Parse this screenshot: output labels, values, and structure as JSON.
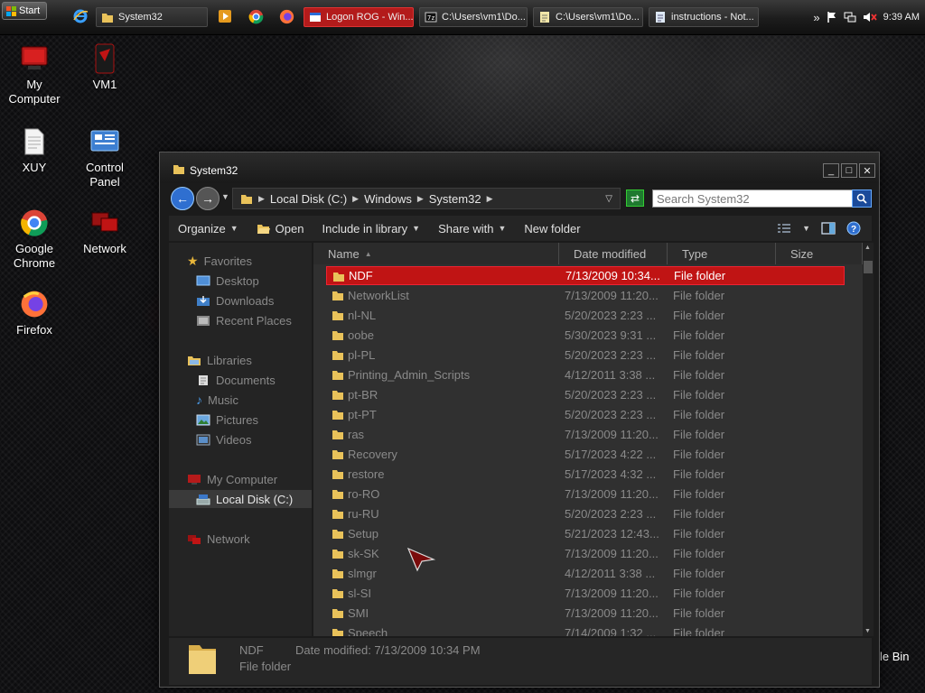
{
  "taskbar": {
    "start_label": "Start",
    "buttons": [
      {
        "label": "System32",
        "active": false
      },
      {
        "label": "Logon ROG - Win...",
        "active": true
      },
      {
        "label": "C:\\Users\\vm1\\Do...",
        "active": false
      },
      {
        "label": "C:\\Users\\vm1\\Do...",
        "active": false
      },
      {
        "label": "instructions - Not...",
        "active": false
      }
    ],
    "clock": "9:39 AM",
    "tray_expand": "»"
  },
  "desktop_icons": [
    {
      "label": "My Computer"
    },
    {
      "label": "VM1"
    },
    {
      "label": "XUY"
    },
    {
      "label": "Control Panel"
    },
    {
      "label": "Google Chrome"
    },
    {
      "label": "Network"
    },
    {
      "label": "Firefox"
    }
  ],
  "recycle_partial": "le Bin",
  "window": {
    "title": "System32",
    "controls": {
      "min": "_",
      "max": "□",
      "close": "✕"
    },
    "breadcrumb": [
      "Local Disk (C:)",
      "Windows",
      "System32"
    ],
    "search_placeholder": "Search System32",
    "toolbar": {
      "organize": "Organize",
      "open": "Open",
      "include": "Include in library",
      "share": "Share with",
      "new_folder": "New folder"
    },
    "nav": {
      "favorites": "Favorites",
      "desktop": "Desktop",
      "downloads": "Downloads",
      "recent": "Recent Places",
      "libraries": "Libraries",
      "documents": "Documents",
      "music": "Music",
      "pictures": "Pictures",
      "videos": "Videos",
      "my_computer": "My Computer",
      "local_disk": "Local Disk (C:)",
      "network": "Network"
    },
    "columns": {
      "name": "Name",
      "date": "Date modified",
      "type": "Type",
      "size": "Size"
    },
    "rows": [
      {
        "name": "NDF",
        "date": "7/13/2009 10:34...",
        "type": "File folder",
        "selected": true
      },
      {
        "name": "NetworkList",
        "date": "7/13/2009 11:20...",
        "type": "File folder"
      },
      {
        "name": "nl-NL",
        "date": "5/20/2023 2:23 ...",
        "type": "File folder"
      },
      {
        "name": "oobe",
        "date": "5/30/2023 9:31 ...",
        "type": "File folder"
      },
      {
        "name": "pl-PL",
        "date": "5/20/2023 2:23 ...",
        "type": "File folder"
      },
      {
        "name": "Printing_Admin_Scripts",
        "date": "4/12/2011 3:38 ...",
        "type": "File folder"
      },
      {
        "name": "pt-BR",
        "date": "5/20/2023 2:23 ...",
        "type": "File folder"
      },
      {
        "name": "pt-PT",
        "date": "5/20/2023 2:23 ...",
        "type": "File folder"
      },
      {
        "name": "ras",
        "date": "7/13/2009 11:20...",
        "type": "File folder"
      },
      {
        "name": "Recovery",
        "date": "5/17/2023 4:22 ...",
        "type": "File folder"
      },
      {
        "name": "restore",
        "date": "5/17/2023 4:32 ...",
        "type": "File folder"
      },
      {
        "name": "ro-RO",
        "date": "7/13/2009 11:20...",
        "type": "File folder"
      },
      {
        "name": "ru-RU",
        "date": "5/20/2023 2:23 ...",
        "type": "File folder"
      },
      {
        "name": "Setup",
        "date": "5/21/2023 12:43...",
        "type": "File folder"
      },
      {
        "name": "sk-SK",
        "date": "7/13/2009 11:20...",
        "type": "File folder"
      },
      {
        "name": "slmgr",
        "date": "4/12/2011 3:38 ...",
        "type": "File folder"
      },
      {
        "name": "sl-SI",
        "date": "7/13/2009 11:20...",
        "type": "File folder"
      },
      {
        "name": "SMI",
        "date": "7/13/2009 11:20...",
        "type": "File folder"
      },
      {
        "name": "Speech",
        "date": "7/14/2009 1:32 ...",
        "type": "File folder"
      }
    ],
    "details": {
      "name": "NDF",
      "modified": "Date modified: 7/13/2009 10:34 PM",
      "type": "File folder"
    }
  },
  "colors": {
    "accent": "#c01414",
    "folder": "#e9c25a"
  }
}
